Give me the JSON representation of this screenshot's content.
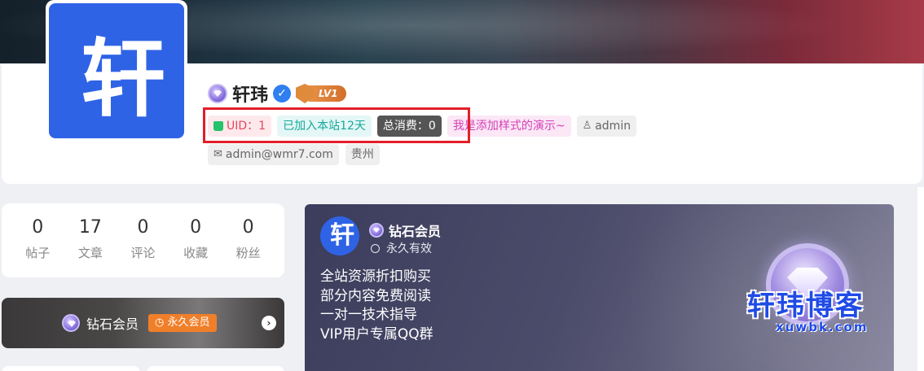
{
  "profile": {
    "avatar_char": "轩",
    "name": "轩玮",
    "level": "LV1",
    "tags": {
      "uid": "UID：1",
      "joined": "已加入本站12天",
      "spent": "总消费：0",
      "custom": "我是添加样式的演示~",
      "role": "admin",
      "email": "admin@wmr7.com",
      "location": "贵州"
    }
  },
  "stats": [
    {
      "value": "0",
      "label": "帖子"
    },
    {
      "value": "17",
      "label": "文章"
    },
    {
      "value": "0",
      "label": "评论"
    },
    {
      "value": "0",
      "label": "收藏"
    },
    {
      "value": "0",
      "label": "粉丝"
    }
  ],
  "vip_bar": {
    "title": "钻石会员",
    "badge": "永久会员"
  },
  "vip_card": {
    "avatar_char": "轩",
    "level_name": "钻石会员",
    "validity": "永久有效",
    "benefits": [
      "全站资源折扣购买",
      "部分内容免费阅读",
      "一对一技术指导",
      "VIP用户专属QQ群"
    ]
  },
  "watermark": {
    "title": "轩玮博客",
    "url": "xuwbk.com"
  },
  "colors": {
    "accent": "#2f63e6",
    "highlight": "#e31e2a",
    "vip_orange": "#f07f2a"
  },
  "icons": [
    "gem-icon",
    "verify-icon",
    "level-shield-icon",
    "thumb-icon",
    "user-icon",
    "mail-icon",
    "clock-icon",
    "chevron-right-icon"
  ]
}
